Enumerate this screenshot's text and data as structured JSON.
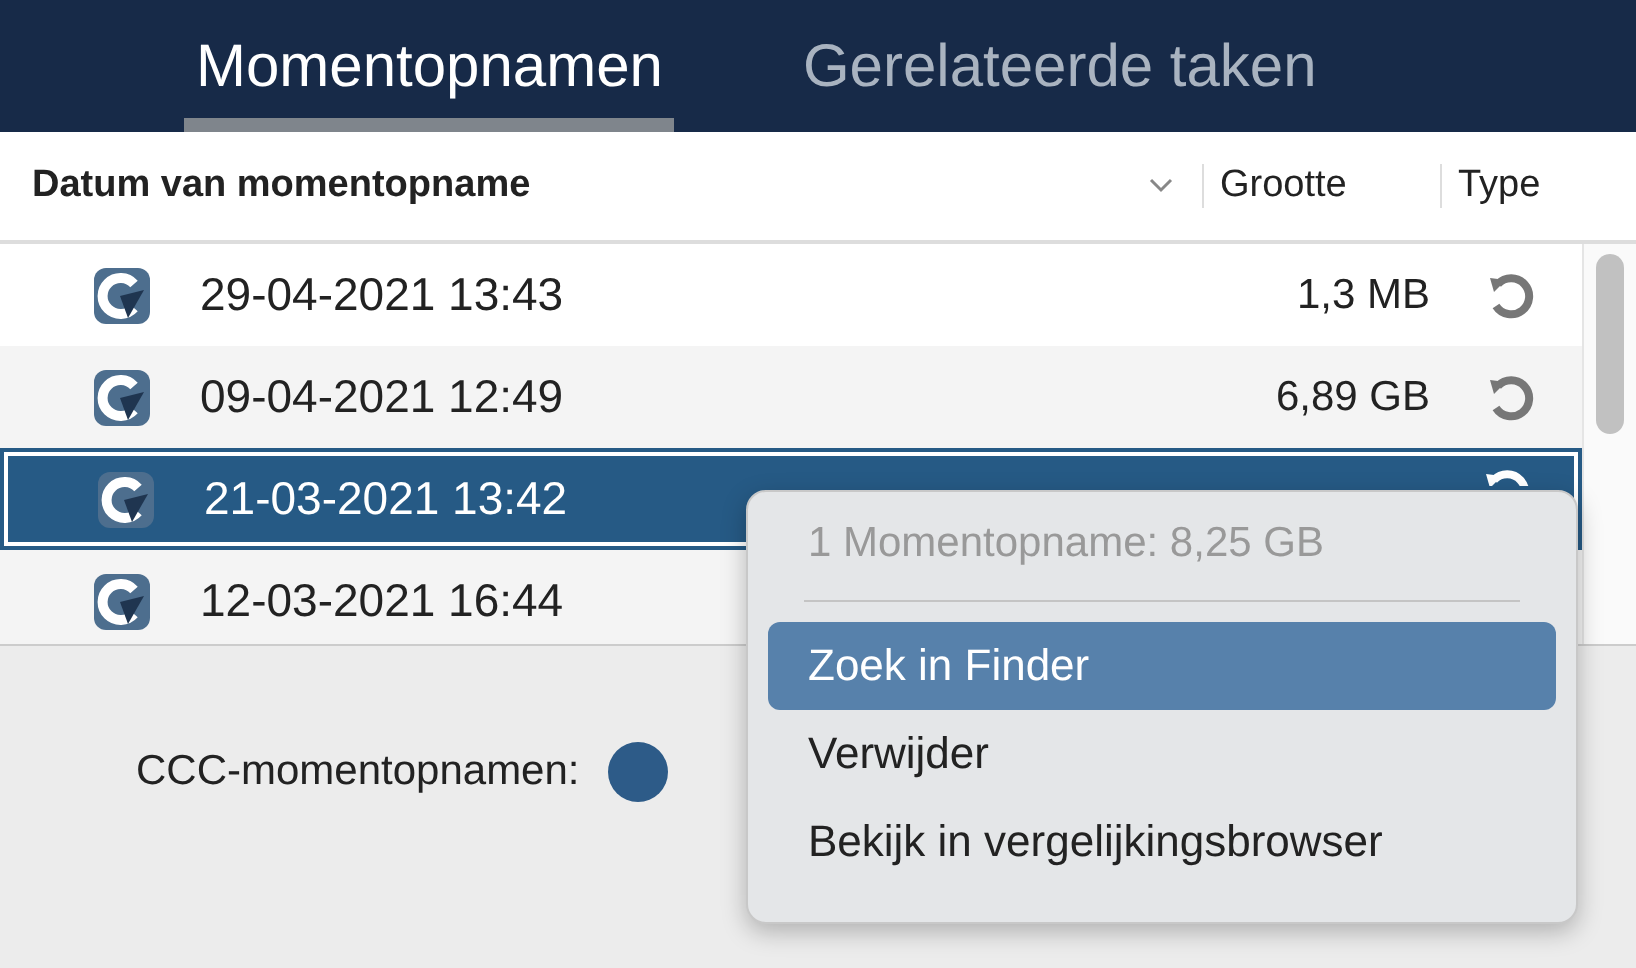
{
  "tabs": [
    {
      "label": "Momentopnamen",
      "selected": true
    },
    {
      "label": "Gerelateerde taken",
      "selected": false
    }
  ],
  "table": {
    "columns": [
      "Datum van momentopname",
      "Grootte",
      "Type"
    ],
    "rows": [
      {
        "date": "29-04-2021 13:43",
        "size": "1,3 MB",
        "selected": false
      },
      {
        "date": "09-04-2021 12:49",
        "size": "6,89 GB",
        "selected": false
      },
      {
        "date": "21-03-2021 13:42",
        "selected": true
      },
      {
        "date": "12-03-2021 16:44",
        "selected": false
      }
    ]
  },
  "settings": {
    "label": "CCC-momentopnamen:"
  },
  "context_menu": {
    "header": "1 Momentopname: 8,25 GB",
    "items": [
      {
        "label": "Zoek in Finder",
        "selected": true
      },
      {
        "label": "Verwijder",
        "selected": false
      },
      {
        "label": "Bekijk in vergelijkingsbrowser",
        "selected": false
      }
    ]
  }
}
